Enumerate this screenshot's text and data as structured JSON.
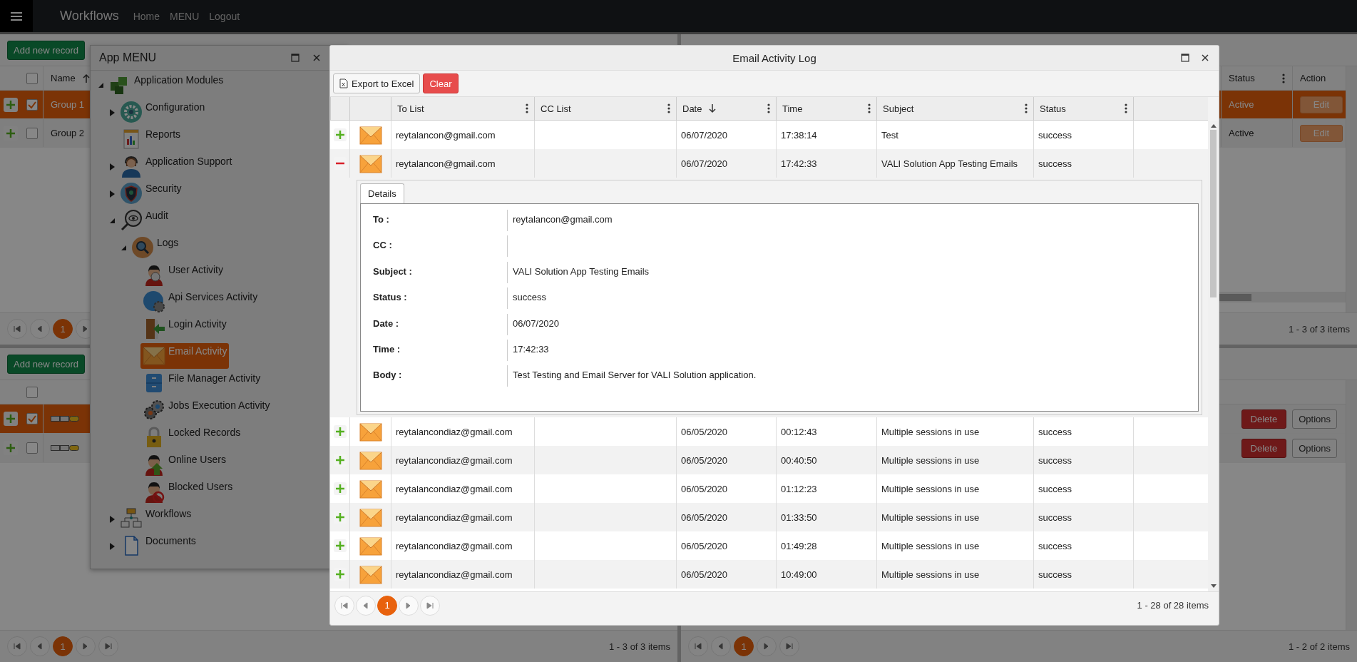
{
  "navbar": {
    "brand": "Workflows",
    "links": [
      "Home",
      "MENU",
      "Logout"
    ]
  },
  "groups_panel": {
    "add_button": "Add new record",
    "select_all_checked": false,
    "column": {
      "label": "Name",
      "sorted": true
    },
    "rows": [
      {
        "name": "Group 1",
        "selected": true,
        "checked": true
      },
      {
        "name": "Group 2",
        "selected": false,
        "checked": false
      }
    ],
    "pager": {
      "page": "1"
    }
  },
  "groups_detail_panel": {
    "columns": [
      {
        "label": "Status",
        "menu": true
      },
      {
        "label": "Action",
        "menu": false
      }
    ],
    "rows": [
      {
        "status": "Active",
        "action": "Edit",
        "selected": true
      },
      {
        "status": "Active",
        "action": "Edit",
        "selected": false
      }
    ],
    "pager": {
      "info": "1 - 3 of 3 items"
    }
  },
  "lower_left_panel": {
    "add_button": "Add new record",
    "select_all_checked": false,
    "rows": [
      {
        "selected": true,
        "checked": true
      },
      {
        "selected": false,
        "checked": false
      }
    ],
    "pager": {
      "page": "1",
      "info": "1 - 3 of 3 items"
    }
  },
  "lower_right_panel": {
    "rows": [
      {
        "delete": "Delete",
        "options": "Options"
      },
      {
        "delete": "Delete",
        "options": "Options"
      }
    ],
    "pager": {
      "page": "1",
      "info": "1 - 2 of 2 items"
    }
  },
  "app_menu": {
    "title": "App MENU",
    "items": [
      {
        "label": "Application Modules",
        "kind": "modules",
        "expandable": true,
        "expanded": true,
        "selected": false,
        "children": [
          {
            "label": "Configuration",
            "kind": "gear",
            "expandable": true,
            "expanded": false,
            "selected": false
          },
          {
            "label": "Reports",
            "kind": "report",
            "expandable": false,
            "selected": false
          },
          {
            "label": "Application Support",
            "kind": "support",
            "expandable": true,
            "expanded": false,
            "selected": false
          },
          {
            "label": "Security",
            "kind": "shield",
            "expandable": true,
            "expanded": false,
            "selected": false
          },
          {
            "label": "Audit",
            "kind": "audit",
            "expandable": true,
            "expanded": true,
            "selected": false,
            "children": [
              {
                "label": "Logs",
                "kind": "search",
                "expandable": true,
                "expanded": true,
                "selected": false,
                "children": [
                  {
                    "label": "User Activity",
                    "kind": "user",
                    "expandable": false,
                    "selected": false
                  },
                  {
                    "label": "Api Services Activity",
                    "kind": "api",
                    "expandable": false,
                    "selected": false
                  },
                  {
                    "label": "Login Activity",
                    "kind": "login",
                    "expandable": false,
                    "selected": false
                  },
                  {
                    "label": "Email Activity",
                    "kind": "email",
                    "expandable": false,
                    "selected": true
                  },
                  {
                    "label": "File Manager Activity",
                    "kind": "files",
                    "expandable": false,
                    "selected": false
                  },
                  {
                    "label": "Jobs Execution Activity",
                    "kind": "jobs",
                    "expandable": false,
                    "selected": false
                  },
                  {
                    "label": "Locked Records",
                    "kind": "lock",
                    "expandable": false,
                    "selected": false
                  },
                  {
                    "label": "Online Users",
                    "kind": "online",
                    "expandable": false,
                    "selected": false
                  },
                  {
                    "label": "Blocked Users",
                    "kind": "blocked",
                    "expandable": false,
                    "selected": false
                  }
                ]
              }
            ]
          },
          {
            "label": "Workflows",
            "kind": "workflow",
            "expandable": true,
            "expanded": false,
            "selected": false
          },
          {
            "label": "Documents",
            "kind": "document",
            "expandable": true,
            "expanded": false,
            "selected": false
          }
        ]
      }
    ]
  },
  "email_dialog": {
    "title": "Email Activity Log",
    "export_button": "Export to Excel",
    "clear_button": "Clear",
    "columns": [
      {
        "label": "To List",
        "sorted": false
      },
      {
        "label": "CC List",
        "sorted": false
      },
      {
        "label": "Date",
        "sorted": true
      },
      {
        "label": "Time",
        "sorted": false
      },
      {
        "label": "Subject",
        "sorted": false
      },
      {
        "label": "Status",
        "sorted": false
      }
    ],
    "rows": [
      {
        "expanded": false,
        "to": "reytalancon@gmail.com",
        "date": "06/07/2020",
        "time": "17:38:14",
        "subject": "Test",
        "status": "success"
      },
      {
        "expanded": true,
        "to": "reytalancon@gmail.com",
        "date": "06/07/2020",
        "time": "17:42:33",
        "subject": "VALI Solution App Testing Emails",
        "status": "success",
        "details": {
          "tab": "Details",
          "fields": [
            {
              "label": "To :",
              "value": "reytalancon@gmail.com"
            },
            {
              "label": "CC :"
            },
            {
              "label": "Subject :",
              "value": "VALI Solution App Testing Emails"
            },
            {
              "label": "Status :",
              "value": "success"
            },
            {
              "label": "Date :",
              "value": "06/07/2020"
            },
            {
              "label": "Time :",
              "value": "17:42:33"
            },
            {
              "label": "Body :",
              "value": "Test Testing and Email Server for VALI Solution application."
            }
          ]
        }
      },
      {
        "expanded": false,
        "to": "reytalancondiaz@gmail.com",
        "date": "06/05/2020",
        "time": "00:12:43",
        "subject": "Multiple sessions in use",
        "status": "success"
      },
      {
        "expanded": false,
        "to": "reytalancondiaz@gmail.com",
        "date": "06/05/2020",
        "time": "00:40:50",
        "subject": "Multiple sessions in use",
        "status": "success"
      },
      {
        "expanded": false,
        "to": "reytalancondiaz@gmail.com",
        "date": "06/05/2020",
        "time": "01:12:23",
        "subject": "Multiple sessions in use",
        "status": "success"
      },
      {
        "expanded": false,
        "to": "reytalancondiaz@gmail.com",
        "date": "06/05/2020",
        "time": "01:33:50",
        "subject": "Multiple sessions in use",
        "status": "success"
      },
      {
        "expanded": false,
        "to": "reytalancondiaz@gmail.com",
        "date": "06/05/2020",
        "time": "01:49:28",
        "subject": "Multiple sessions in use",
        "status": "success"
      },
      {
        "expanded": false,
        "to": "reytalancondiaz@gmail.com",
        "date": "06/05/2020",
        "time": "10:49:00",
        "subject": "Multiple sessions in use",
        "status": "success"
      }
    ],
    "pager": {
      "page": "1",
      "info": "1 - 28 of 28 items"
    }
  }
}
